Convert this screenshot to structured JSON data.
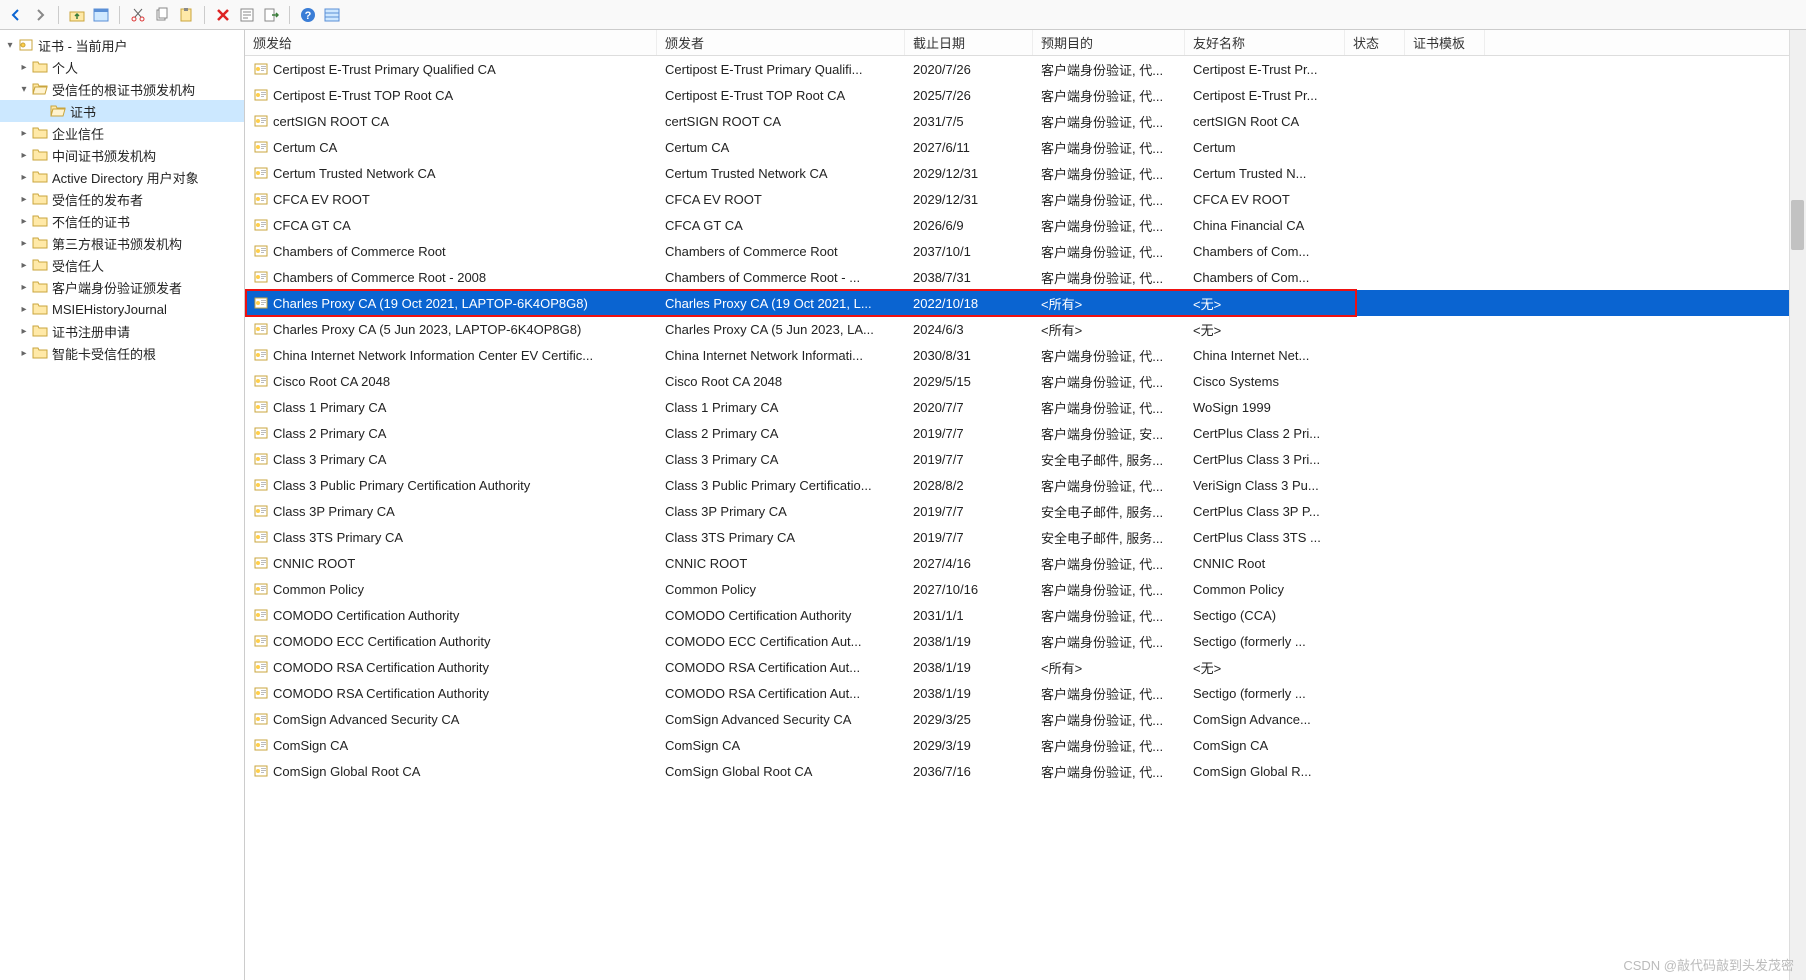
{
  "toolbar_icons": [
    "back-icon",
    "forward-icon",
    "sep",
    "folder-up-icon",
    "window-icon",
    "sep",
    "cut-icon",
    "copy-icon",
    "paste-icon",
    "sep",
    "delete-icon",
    "properties-icon",
    "export-icon",
    "sep",
    "help-icon",
    "list-icon"
  ],
  "tree": {
    "root": "证书 - 当前用户",
    "items": [
      {
        "label": "个人",
        "expandable": true
      },
      {
        "label": "受信任的根证书颁发机构",
        "expandable": true,
        "expanded": true,
        "children": [
          {
            "label": "证书",
            "selected": true
          }
        ]
      },
      {
        "label": "企业信任",
        "expandable": true
      },
      {
        "label": "中间证书颁发机构",
        "expandable": true
      },
      {
        "label": "Active Directory 用户对象",
        "expandable": true
      },
      {
        "label": "受信任的发布者",
        "expandable": true
      },
      {
        "label": "不信任的证书",
        "expandable": true
      },
      {
        "label": "第三方根证书颁发机构",
        "expandable": true
      },
      {
        "label": "受信任人",
        "expandable": true
      },
      {
        "label": "客户端身份验证颁发者",
        "expandable": true
      },
      {
        "label": "MSIEHistoryJournal",
        "expandable": true
      },
      {
        "label": "证书注册申请",
        "expandable": true
      },
      {
        "label": "智能卡受信任的根",
        "expandable": true
      }
    ]
  },
  "columns": [
    "颁发给",
    "颁发者",
    "截止日期",
    "预期目的",
    "友好名称",
    "状态",
    "证书模板"
  ],
  "rows": [
    {
      "c": [
        "Certipost E-Trust Primary Qualified CA",
        "Certipost E-Trust Primary Qualifi...",
        "2020/7/26",
        "客户端身份验证, 代...",
        "Certipost E-Trust Pr...",
        "",
        ""
      ]
    },
    {
      "c": [
        "Certipost E-Trust TOP Root CA",
        "Certipost E-Trust TOP Root CA",
        "2025/7/26",
        "客户端身份验证, 代...",
        "Certipost E-Trust Pr...",
        "",
        ""
      ]
    },
    {
      "c": [
        "certSIGN ROOT CA",
        "certSIGN ROOT CA",
        "2031/7/5",
        "客户端身份验证, 代...",
        "certSIGN Root CA",
        "",
        ""
      ]
    },
    {
      "c": [
        "Certum CA",
        "Certum CA",
        "2027/6/11",
        "客户端身份验证, 代...",
        "Certum",
        "",
        ""
      ]
    },
    {
      "c": [
        "Certum Trusted Network CA",
        "Certum Trusted Network CA",
        "2029/12/31",
        "客户端身份验证, 代...",
        "Certum Trusted N...",
        "",
        ""
      ]
    },
    {
      "c": [
        "CFCA EV ROOT",
        "CFCA EV ROOT",
        "2029/12/31",
        "客户端身份验证, 代...",
        "CFCA EV ROOT",
        "",
        ""
      ]
    },
    {
      "c": [
        "CFCA GT CA",
        "CFCA GT CA",
        "2026/6/9",
        "客户端身份验证, 代...",
        "China Financial CA",
        "",
        ""
      ]
    },
    {
      "c": [
        "Chambers of Commerce Root",
        "Chambers of Commerce Root",
        "2037/10/1",
        "客户端身份验证, 代...",
        "Chambers of Com...",
        "",
        ""
      ]
    },
    {
      "c": [
        "Chambers of Commerce Root - 2008",
        "Chambers of Commerce Root - ...",
        "2038/7/31",
        "客户端身份验证, 代...",
        "Chambers of Com...",
        "",
        ""
      ]
    },
    {
      "c": [
        "Charles Proxy CA (19 Oct 2021, LAPTOP-6K4OP8G8)",
        "Charles Proxy CA (19 Oct 2021, L...",
        "2022/10/18",
        "<所有>",
        "<无>",
        "",
        ""
      ],
      "selected": true,
      "highlighted": true
    },
    {
      "c": [
        "Charles Proxy CA (5 Jun 2023, LAPTOP-6K4OP8G8)",
        "Charles Proxy CA (5 Jun 2023, LA...",
        "2024/6/3",
        "<所有>",
        "<无>",
        "",
        ""
      ]
    },
    {
      "c": [
        "China Internet Network Information Center EV Certific...",
        "China Internet Network Informati...",
        "2030/8/31",
        "客户端身份验证, 代...",
        "China Internet Net...",
        "",
        ""
      ]
    },
    {
      "c": [
        "Cisco Root CA 2048",
        "Cisco Root CA 2048",
        "2029/5/15",
        "客户端身份验证, 代...",
        "Cisco Systems",
        "",
        ""
      ]
    },
    {
      "c": [
        "Class 1 Primary CA",
        "Class 1 Primary CA",
        "2020/7/7",
        "客户端身份验证, 代...",
        "WoSign 1999",
        "",
        ""
      ]
    },
    {
      "c": [
        "Class 2 Primary CA",
        "Class 2 Primary CA",
        "2019/7/7",
        "客户端身份验证, 安...",
        "CertPlus Class 2 Pri...",
        "",
        ""
      ]
    },
    {
      "c": [
        "Class 3 Primary CA",
        "Class 3 Primary CA",
        "2019/7/7",
        "安全电子邮件, 服务...",
        "CertPlus Class 3 Pri...",
        "",
        ""
      ]
    },
    {
      "c": [
        "Class 3 Public Primary Certification Authority",
        "Class 3 Public Primary Certificatio...",
        "2028/8/2",
        "客户端身份验证, 代...",
        "VeriSign Class 3 Pu...",
        "",
        ""
      ]
    },
    {
      "c": [
        "Class 3P Primary CA",
        "Class 3P Primary CA",
        "2019/7/7",
        "安全电子邮件, 服务...",
        "CertPlus Class 3P P...",
        "",
        ""
      ]
    },
    {
      "c": [
        "Class 3TS Primary CA",
        "Class 3TS Primary CA",
        "2019/7/7",
        "安全电子邮件, 服务...",
        "CertPlus Class 3TS ...",
        "",
        ""
      ]
    },
    {
      "c": [
        "CNNIC ROOT",
        "CNNIC ROOT",
        "2027/4/16",
        "客户端身份验证, 代...",
        "CNNIC Root",
        "",
        ""
      ]
    },
    {
      "c": [
        "Common Policy",
        "Common Policy",
        "2027/10/16",
        "客户端身份验证, 代...",
        "Common Policy",
        "",
        ""
      ]
    },
    {
      "c": [
        "COMODO Certification Authority",
        "COMODO Certification Authority",
        "2031/1/1",
        "客户端身份验证, 代...",
        "Sectigo (CCA)",
        "",
        ""
      ]
    },
    {
      "c": [
        "COMODO ECC Certification Authority",
        "COMODO ECC Certification Aut...",
        "2038/1/19",
        "客户端身份验证, 代...",
        "Sectigo (formerly ...",
        "",
        ""
      ]
    },
    {
      "c": [
        "COMODO RSA Certification Authority",
        "COMODO RSA Certification Aut...",
        "2038/1/19",
        "<所有>",
        "<无>",
        "",
        ""
      ]
    },
    {
      "c": [
        "COMODO RSA Certification Authority",
        "COMODO RSA Certification Aut...",
        "2038/1/19",
        "客户端身份验证, 代...",
        "Sectigo (formerly ...",
        "",
        ""
      ]
    },
    {
      "c": [
        "ComSign Advanced Security CA",
        "ComSign Advanced Security CA",
        "2029/3/25",
        "客户端身份验证, 代...",
        "ComSign Advance...",
        "",
        ""
      ]
    },
    {
      "c": [
        "ComSign CA",
        "ComSign CA",
        "2029/3/19",
        "客户端身份验证, 代...",
        "ComSign CA",
        "",
        ""
      ]
    },
    {
      "c": [
        "ComSign Global Root CA",
        "ComSign Global Root CA",
        "2036/7/16",
        "客户端身份验证, 代...",
        "ComSign Global R...",
        "",
        ""
      ]
    }
  ],
  "watermark": "CSDN @敲代码敲到头发茂密"
}
